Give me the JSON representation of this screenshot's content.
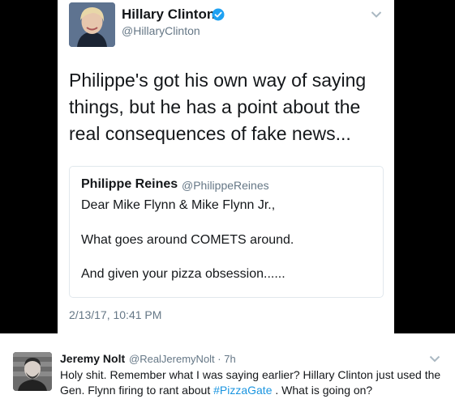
{
  "embedded_tweet": {
    "author_name": "Hillary Clinton",
    "author_handle": "@HillaryClinton",
    "verified": true,
    "text": "Philippe's got his own way of saying things, but he has a point about the real consequences of fake news...",
    "quote": {
      "author_name": "Philippe Reines",
      "author_handle": "@PhilippeReines",
      "line1": "Dear Mike Flynn & Mike Flynn Jr.,",
      "line2": "What goes around COMETS around.",
      "line3": "And given your pizza obsession......"
    },
    "timestamp": "2/13/17, 10:41 PM"
  },
  "reply_tweet": {
    "author_name": "Jeremy Nolt",
    "meta": "@RealJeremyNolt · 7h",
    "text_before": "Holy shit. Remember what I was saying earlier? Hillary Clinton just used the Gen. Flynn firing to rant about ",
    "hashtag": "#PizzaGate",
    "text_after": " . What is going on?"
  },
  "colors": {
    "verified_blue": "#1da1f2",
    "link_blue": "#1b95e0",
    "secondary_text": "#657786"
  },
  "icons": [
    "verified-badge-icon",
    "chevron-down-icon"
  ]
}
